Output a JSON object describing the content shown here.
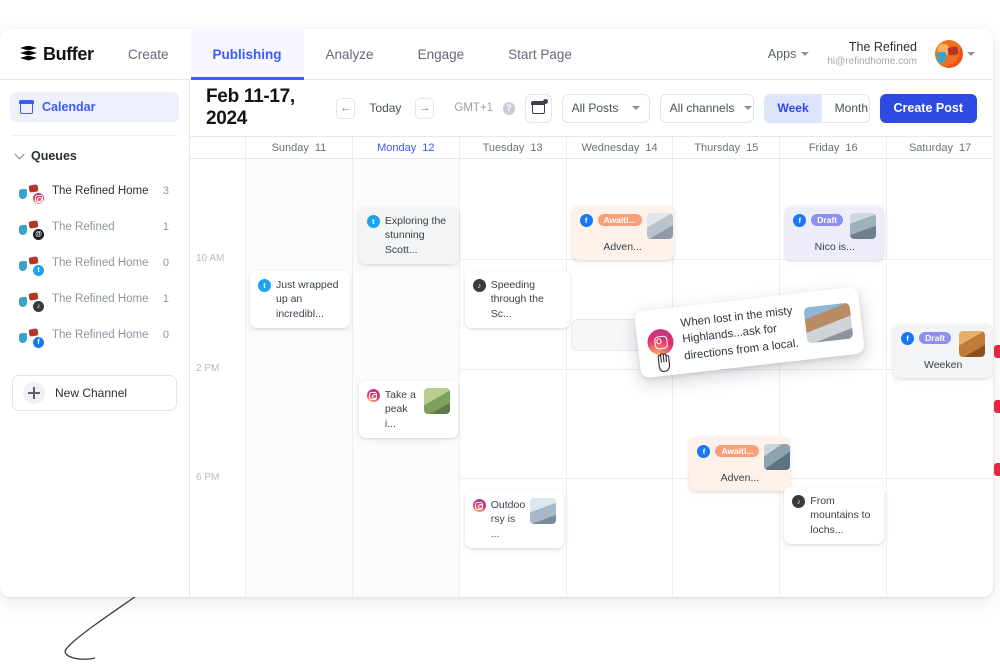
{
  "nav": {
    "brand": "Buffer",
    "tabs": [
      {
        "label": "Create",
        "active": false
      },
      {
        "label": "Publishing",
        "active": true
      },
      {
        "label": "Analyze",
        "active": false
      },
      {
        "label": "Engage",
        "active": false
      },
      {
        "label": "Start Page",
        "active": false
      }
    ],
    "apps_label": "Apps",
    "account_name": "The Refined",
    "account_email": "hi@refindhome.com"
  },
  "sidebar": {
    "calendar_label": "Calendar",
    "queues_label": "Queues",
    "channels": [
      {
        "name": "The Refined Home",
        "count": "3",
        "network": "instagram",
        "glyph": "",
        "active": true
      },
      {
        "name": "The Refined",
        "count": "1",
        "network": "threads",
        "glyph": "@",
        "active": false
      },
      {
        "name": "The Refined Home",
        "count": "0",
        "network": "twitter",
        "glyph": "t",
        "active": false
      },
      {
        "name": "The Refined Home",
        "count": "1",
        "network": "tiktok",
        "glyph": "♪",
        "active": false
      },
      {
        "name": "The Refined Home",
        "count": "0",
        "network": "facebook",
        "glyph": "f",
        "active": false
      }
    ],
    "new_channel_label": "New Channel"
  },
  "toolbar": {
    "range_title": "Feb 11-17, 2024",
    "prev_label": "←",
    "next_label": "→",
    "today_label": "Today",
    "timezone": "GMT+1",
    "help_label": "?",
    "posts_filter": "All Posts",
    "channels_filter": "All channels",
    "view_week": "Week",
    "view_month": "Month",
    "create_post": "Create Post"
  },
  "calendar": {
    "days": [
      {
        "name": "Sunday",
        "num": "11",
        "today": false
      },
      {
        "name": "Monday",
        "num": "12",
        "today": true
      },
      {
        "name": "Tuesday",
        "num": "13",
        "today": false
      },
      {
        "name": "Wednesday",
        "num": "14",
        "today": false
      },
      {
        "name": "Thursday",
        "num": "15",
        "today": false
      },
      {
        "name": "Friday",
        "num": "16",
        "today": false
      },
      {
        "name": "Saturday",
        "num": "17",
        "today": false
      }
    ],
    "times": [
      "10 AM",
      "2 PM",
      "6 PM"
    ],
    "posts": {
      "p1": {
        "text": "Exploring the stunning Scott...",
        "network": "twitter",
        "glyph": "t"
      },
      "p2": {
        "text": "Adven...",
        "badge": "Awaiti...",
        "network": "facebook",
        "glyph": "f"
      },
      "p3": {
        "text": "Nico is...",
        "badge": "Draft",
        "network": "facebook",
        "glyph": "f"
      },
      "p4": {
        "text": "Just wrapped up an incredibl...",
        "network": "twitter",
        "glyph": "t"
      },
      "p5": {
        "text": "Speeding through the Sc...",
        "network": "tiktok",
        "glyph": "♪"
      },
      "p6": {
        "text": "Weeken",
        "badge": "Draft",
        "network": "facebook",
        "glyph": "f"
      },
      "p7": {
        "text": "Take a peak i...",
        "network": "instagram",
        "glyph": ""
      },
      "p8": {
        "text": "Adven...",
        "badge": "Awaiti...",
        "network": "facebook",
        "glyph": "f"
      },
      "p9": {
        "text": "Outdoo rsy is ...",
        "network": "instagram",
        "glyph": ""
      },
      "p10": {
        "text": "From mountains to lochs...",
        "network": "tiktok",
        "glyph": "♪"
      }
    },
    "dragging_post": {
      "line1": "When lost in the misty",
      "line2": "Highlands...ask for",
      "line3": "directions from a local.",
      "network": "instagram"
    }
  },
  "colors": {
    "accent": "#3d5afe",
    "create_button": "#2f4ae0",
    "draft_badge": "#8f8ff0",
    "awaiting_badge": "#f6a07a",
    "instagram": "#e1306c",
    "facebook": "#1877f2",
    "twitter": "#1da1f2",
    "tiktok": "#3a3a3a",
    "threads": "#1b1b1b"
  }
}
